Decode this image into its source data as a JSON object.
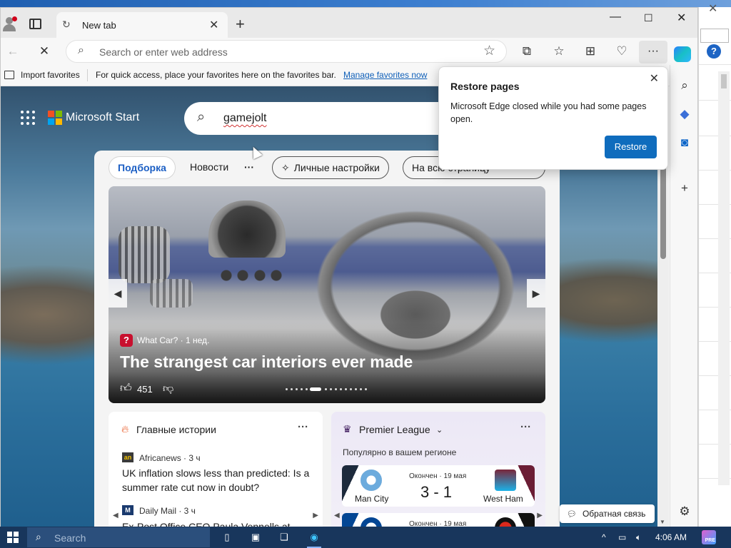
{
  "browser": {
    "tab_title": "New tab",
    "address_placeholder": "Search or enter web address",
    "favorites_bar": {
      "import_label": "Import favorites",
      "tip": "For quick access, place your favorites here on the favorites bar.",
      "manage_link": "Manage favorites now"
    }
  },
  "popup": {
    "title": "Restore pages",
    "body": "Microsoft Edge closed while you had some pages open.",
    "button": "Restore"
  },
  "page": {
    "brand": "Microsoft Start",
    "search_query": "gamejolt",
    "tabs": [
      {
        "label": "Подборка"
      },
      {
        "label": "Новости"
      },
      {
        "label": "···"
      },
      {
        "label": "Личные настройки"
      },
      {
        "label": "На всю страницу"
      }
    ],
    "hero": {
      "source": "What Car? · 1 нед.",
      "headline": "The strangest car interiors ever made",
      "likes": "451"
    },
    "top_stories": {
      "title": "Главные истории",
      "articles": [
        {
          "source": "Africanews · 3 ч",
          "title": "UK inflation slows less than predicted: Is a summer rate cut now in doubt?"
        },
        {
          "source": "Daily Mail · 3 ч",
          "title": "Ex-Post Office CEO Paula Vennells at"
        }
      ]
    },
    "league": {
      "title": "Premier League",
      "subtitle": "Популярно в вашем регионе",
      "matches": [
        {
          "status": "Окончен · 19 мая",
          "score": "3 - 1",
          "home": "Man City",
          "away": "West Ham"
        },
        {
          "status": "Окончен · 19 мая",
          "score": "",
          "home": "",
          "away": ""
        }
      ]
    },
    "feedback": "Обратная связь"
  },
  "taskbar": {
    "search_placeholder": "Search",
    "time": "4:06 AM"
  },
  "colors": {
    "accent": "#0f6cbd",
    "taskbar": "#18365c",
    "active_tab_text": "#1c5fc4"
  }
}
